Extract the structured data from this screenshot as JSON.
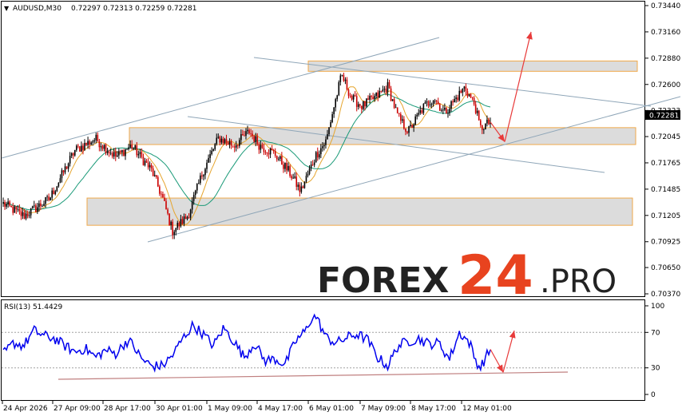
{
  "colors": {
    "background": "#ffffff",
    "border": "#000000",
    "bull_candle": "#000000",
    "bear_candle": "#cc0000",
    "ma_fast": "#e6a52e",
    "ma_slow": "#1a9a78",
    "channel": "#8fa6b8",
    "zone_fill": "#dcdcdc",
    "zone_border": "#f0a94a",
    "forecast_arrow": "#e83a3a",
    "rsi_line": "#0000ee",
    "rsi_trendline": "#c08080",
    "rsi_level": "#a0a0a0",
    "price_badge": "#000000",
    "watermark_dark": "#222222",
    "watermark_accent": "#e8431f"
  },
  "chart_data": [
    {
      "type": "candlestick",
      "symbol": "AUDUSD",
      "timeframe": "M30",
      "header_label": "AUDUSD,M30",
      "ohlc_label": "0.72297 0.72313 0.72259 0.72281",
      "last_price_label": "0.72281",
      "ylim": [
        0.7037,
        0.7344
      ],
      "yticks": [
        "0.73440",
        "0.73160",
        "0.72880",
        "0.72600",
        "0.72323",
        "0.72045",
        "0.71765",
        "0.71485",
        "0.71205",
        "0.70925",
        "0.70650",
        "0.70370"
      ],
      "xticks": [
        "24 Apr 2026",
        "27 Apr 09:00",
        "28 Apr 17:00",
        "30 Apr 01:00",
        "1 May 09:00",
        "4 May 17:00",
        "6 May 01:00",
        "7 May 09:00",
        "8 May 17:00",
        "12 May 01:00"
      ],
      "close_path": [
        [
          0,
          0.7133
        ],
        [
          4,
          0.712
        ],
        [
          9,
          0.7138
        ],
        [
          14,
          0.719
        ],
        [
          18,
          0.7202
        ],
        [
          22,
          0.7183
        ],
        [
          25,
          0.7195
        ],
        [
          29,
          0.7168
        ],
        [
          31,
          0.714
        ],
        [
          33,
          0.7104
        ],
        [
          36,
          0.712
        ],
        [
          39,
          0.7168
        ],
        [
          42,
          0.7203
        ],
        [
          45,
          0.7195
        ],
        [
          48,
          0.721
        ],
        [
          50,
          0.7195
        ],
        [
          53,
          0.7186
        ],
        [
          56,
          0.7165
        ],
        [
          58,
          0.7146
        ],
        [
          61,
          0.7185
        ],
        [
          63,
          0.72
        ],
        [
          64,
          0.7225
        ],
        [
          66,
          0.727
        ],
        [
          68,
          0.7245
        ],
        [
          70,
          0.7237
        ],
        [
          73,
          0.7248
        ],
        [
          75,
          0.7258
        ],
        [
          77,
          0.7225
        ],
        [
          79,
          0.721
        ],
        [
          82,
          0.7236
        ],
        [
          84,
          0.7246
        ],
        [
          86,
          0.723
        ],
        [
          88,
          0.7243
        ],
        [
          90,
          0.7257
        ],
        [
          92,
          0.7238
        ],
        [
          93,
          0.7213
        ],
        [
          95,
          0.722
        ]
      ],
      "zones": [
        {
          "low": 0.7274,
          "high": 0.7285
        },
        {
          "low": 0.7196,
          "high": 0.7214
        },
        {
          "low": 0.711,
          "high": 0.7139
        }
      ],
      "forecast": {
        "down_to": 0.7199,
        "up_to": 0.7316
      }
    },
    {
      "type": "line",
      "indicator_label": "RSI(13) 51.4429",
      "ylim": [
        0,
        100
      ],
      "yticks": [
        "100",
        "70",
        "30",
        "0"
      ],
      "levels": [
        70,
        30
      ],
      "points": [
        [
          0,
          45
        ],
        [
          2,
          58
        ],
        [
          4,
          55
        ],
        [
          6,
          72
        ],
        [
          8,
          66
        ],
        [
          10,
          63
        ],
        [
          12,
          55
        ],
        [
          14,
          48
        ],
        [
          16,
          52
        ],
        [
          18,
          42
        ],
        [
          20,
          50
        ],
        [
          22,
          46
        ],
        [
          24,
          60
        ],
        [
          25,
          58
        ],
        [
          27,
          40
        ],
        [
          29,
          32
        ],
        [
          31,
          32
        ],
        [
          33,
          44
        ],
        [
          35,
          63
        ],
        [
          37,
          78
        ],
        [
          39,
          68
        ],
        [
          41,
          55
        ],
        [
          43,
          75
        ],
        [
          45,
          60
        ],
        [
          47,
          42
        ],
        [
          49,
          58
        ],
        [
          51,
          38
        ],
        [
          53,
          40
        ],
        [
          55,
          34
        ],
        [
          57,
          60
        ],
        [
          59,
          72
        ],
        [
          60,
          85
        ],
        [
          61,
          88
        ],
        [
          63,
          64
        ],
        [
          65,
          58
        ],
        [
          67,
          64
        ],
        [
          69,
          68
        ],
        [
          71,
          62
        ],
        [
          73,
          42
        ],
        [
          75,
          32
        ],
        [
          77,
          55
        ],
        [
          79,
          60
        ],
        [
          81,
          63
        ],
        [
          83,
          57
        ],
        [
          85,
          58
        ],
        [
          87,
          40
        ],
        [
          89,
          70
        ],
        [
          91,
          58
        ],
        [
          92,
          40
        ],
        [
          93,
          30
        ],
        [
          95,
          51
        ]
      ],
      "forecast": {
        "down_to": 25,
        "up_to": 72
      }
    }
  ],
  "watermark": {
    "part1": "FOREX",
    "part2": "24",
    "part3": ".PRO"
  }
}
